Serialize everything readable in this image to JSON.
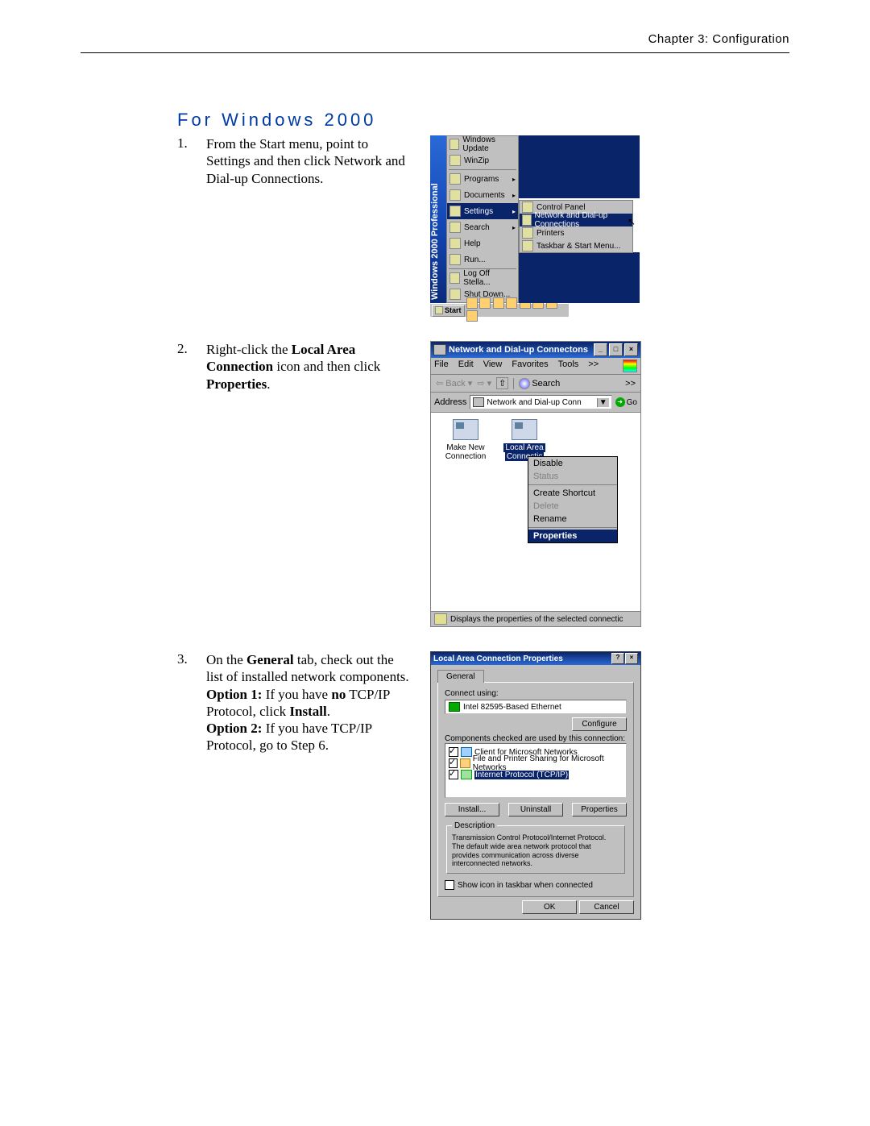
{
  "header": "Chapter 3: Configuration",
  "section_title": "For Windows 2000",
  "steps": {
    "s1": {
      "num": "1.",
      "text": "From the Start menu, point to Settings and then click Network and Dial-up Connections."
    },
    "s2": {
      "num": "2.",
      "pre": "Right-click the ",
      "b1": "Local Area Connection",
      "mid": " icon and then click ",
      "b2": "Properties",
      "post": "."
    },
    "s3": {
      "num": "3.",
      "l1a": "On the ",
      "l1b": "General",
      "l1c": " tab, check out the list of installed network components.",
      "l2a": "Option 1:",
      "l2b": " If you have ",
      "l2c": "no",
      "l2d": " TCP/IP Protocol, click ",
      "l2e": "Install",
      "l2f": ".",
      "l3a": "Option 2:",
      "l3b": " If you have TCP/IP Protocol, go to Step 6."
    }
  },
  "fig1": {
    "brand": "Windows 2000 Professional",
    "menu1": [
      "Windows Update",
      "WinZip",
      "Programs",
      "Documents",
      "Settings",
      "Search",
      "Help",
      "Run...",
      "Log Off Stella...",
      "Shut Down..."
    ],
    "menu2": [
      "Control Panel",
      "Network and Dial-up Connections",
      "Printers",
      "Taskbar & Start Menu..."
    ],
    "start": "Start"
  },
  "fig2": {
    "title": "Network and Dial-up Connectons",
    "menus": [
      "File",
      "Edit",
      "View",
      "Favorites",
      "Tools",
      ">>"
    ],
    "back": "Back",
    "search": "Search",
    "chev": ">>",
    "addr_label": "Address",
    "addr_value": "Network and Dial-up Conn",
    "go": "Go",
    "conn1": "Make New Connection",
    "conn2a": "Local Area",
    "conn2b": "Connectic",
    "ctx": [
      "Disable",
      "Status",
      "Create Shortcut",
      "Delete",
      "Rename",
      "Properties"
    ],
    "status": "Displays the properties of the selected connectic"
  },
  "fig3": {
    "title": "Local Area Connection Properties",
    "tab": "General",
    "connect_using": "Connect using:",
    "adapter": "Intel 82595-Based Ethernet",
    "configure": "Configure",
    "components_lbl": "Components checked are used by this connection:",
    "comp1": "Client for Microsoft Networks",
    "comp2": "File and Printer Sharing for Microsoft Networks",
    "comp3": "Internet Protocol (TCP/IP)",
    "install": "Install...",
    "uninstall": "Uninstall",
    "properties": "Properties",
    "desc_lbl": "Description",
    "desc": "Transmission Control Protocol/Internet Protocol. The default wide area network protocol that provides communication across diverse interconnected networks.",
    "show": "Show icon in taskbar when connected",
    "ok": "OK",
    "cancel": "Cancel"
  }
}
